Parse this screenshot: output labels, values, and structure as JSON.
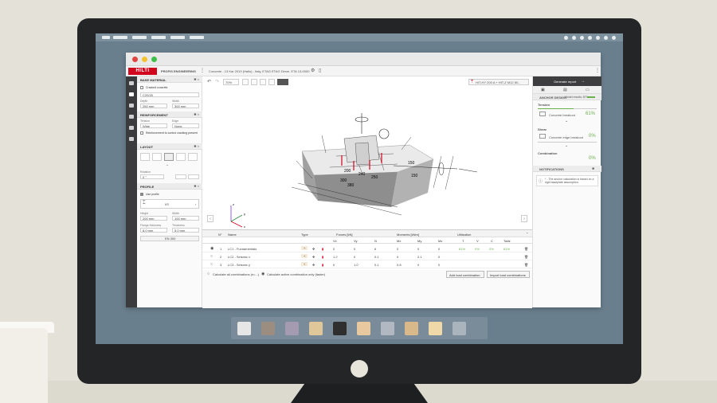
{
  "app": {
    "brand": "HILTI",
    "product": "PROFIS ENGINEERING",
    "doc_title": "Concrete - 13 Kar 2019 (Hallo) - Italy, ETAG ETAG Dimm. ETA 13-0000"
  },
  "left_panel": {
    "base_material": {
      "title": "BASE MATERIAL",
      "cracked_label": "Cracked concrete",
      "concrete": "C20/25",
      "depth_label": "Depth",
      "depth_value": "250 mm",
      "width_label": "Width",
      "width_value": "300 mm"
    },
    "reinforcement": {
      "title": "REINFORCEMENT",
      "tension_label": "Tension",
      "tension_value": "Wide",
      "edge_label": "Edge",
      "edge_value": "None",
      "control_label": "Reinforcement to control cracking present"
    },
    "layout": {
      "title": "LAYOUT",
      "rotation_label": "Rotation",
      "rotation_value": "0 °"
    },
    "profile": {
      "title": "PROFILE",
      "use_label": "Use profile",
      "profile_value": "I/S",
      "height_label": "Height",
      "height_value": "200 mm",
      "width_label": "Width",
      "width_value": "100 mm",
      "flange_label": "Flange thickness",
      "flange_value": "8.0 mm",
      "thick_label": "Thickness",
      "thick_value": "5.0 mm",
      "standard": "EN 300"
    }
  },
  "toolbar": {
    "zoom": "70%",
    "anchor_select": "HIT-HY 200 A + HIT-Z M12 80..."
  },
  "model": {
    "dims": [
      "200",
      "240",
      "250",
      "300",
      "380",
      "150",
      "150"
    ],
    "axis_x": "x",
    "axis_y": "y",
    "axis_z": "z"
  },
  "right_panel": {
    "generate": "Generate report",
    "design_title": "ANCHOR DESIGN",
    "design_sub": "Model results: 87%",
    "tension_title": "Tension",
    "tension_item": "Concrete breakout",
    "tension_value": "61%",
    "tension_frac": 0.61,
    "shear_title": "Shear",
    "shear_item": "Concrete edge breakout",
    "shear_value": "0%",
    "shear_frac": 0.0,
    "combination_title": "Combination",
    "combination_value": "0%",
    "notifications_title": "NOTIFICATIONS",
    "notification_text": "* - The anchor calculation is based on a rigid baseplate assumption."
  },
  "table": {
    "headers": {
      "n": "N°",
      "name": "Name",
      "type": "Type",
      "forces": "Forces [kN]",
      "moments": "Moments [kNm]",
      "util": "Utilization"
    },
    "subheaders": [
      "Vx",
      "Vy",
      "N",
      "Mx",
      "My",
      "Mz",
      "T",
      "V",
      "C",
      "Total"
    ],
    "rows": [
      {
        "n": "1",
        "name": "LC1 - Fundamentals",
        "v": [
          "0",
          "0",
          "6",
          "0",
          "0",
          "0"
        ],
        "u": [
          "61%",
          "0%",
          "0%",
          "61%"
        ]
      },
      {
        "n": "2",
        "name": "LC2 - Seismic x",
        "v": [
          "1.2",
          "0",
          "0.1",
          "0",
          "2.1",
          "0"
        ],
        "u": [
          "",
          "",
          "",
          ""
        ]
      },
      {
        "n": "3",
        "name": "LC3 - Seismic y",
        "v": [
          "0",
          "1.0",
          "0.1",
          "0.8",
          "0",
          "0"
        ],
        "u": [
          "",
          "",
          "",
          ""
        ]
      }
    ],
    "opt1": "Calculate all combinations (n=...)",
    "opt2": "Calculate active combination only (faster)",
    "add_btn": "Add load combination",
    "import_btn": "Import load combinations"
  }
}
